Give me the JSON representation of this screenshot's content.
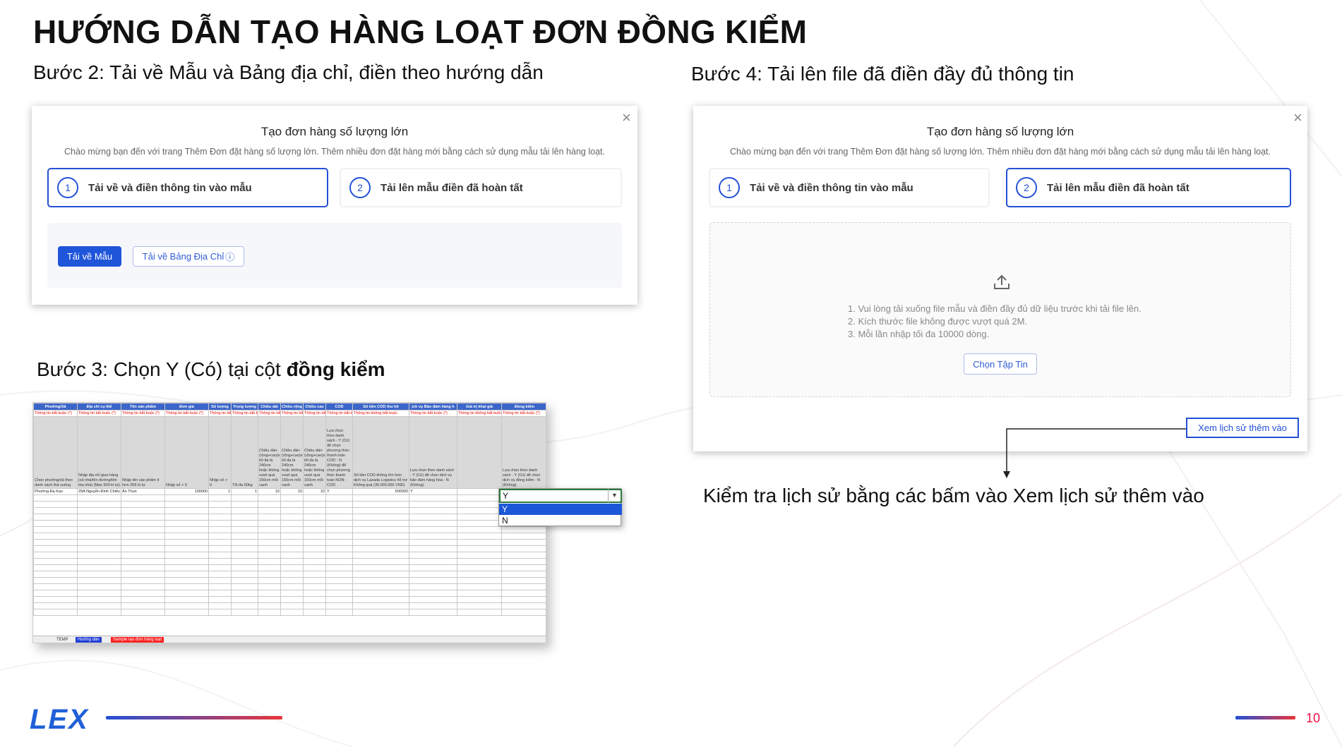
{
  "slide": {
    "title": "HƯỚNG DẪN TẠO HÀNG LOẠT ĐƠN ĐỒNG KIỂM",
    "step2": "Bước 2: Tải về Mẫu và Bảng địa chỉ, điền theo hướng dẫn",
    "step3_prefix": "Bước 3: Chọn Y (Có) tại cột ",
    "step3_bold": "đồng kiểm",
    "step4": "Bước 4: Tải lên file đã điền đầy đủ thông tin",
    "note": "Kiểm tra lịch sử bằng các bấm vào Xem lịch sử thêm vào",
    "logo": "LEX",
    "page_number": "10",
    "colors": {
      "accent_blue": "#2450d6",
      "accent_red": "#e8363c"
    }
  },
  "modal": {
    "title": "Tạo đơn hàng số lượng lớn",
    "description": "Chào mừng bạn đến với trang Thêm Đơn đặt hàng số lượng lớn. Thêm nhiều đơn đặt hàng mới bằng cách sử dụng mẫu tải lên hàng loạt.",
    "close_icon": "×",
    "step1_num": "1",
    "step1_label": "Tải về và điền thông tin vào mẫu",
    "step2_num": "2",
    "step2_label": "Tải lên mẫu điền đã hoàn tất",
    "download_template": "Tải về Mẫu",
    "download_address": "Tải về Bảng Địa Chỉ",
    "info_icon": "ⓘ",
    "upload_hints": [
      "1. Vui lòng tải xuống file mẫu và điền đầy đủ dữ liệu trước khi tải file lên.",
      "2. Kích thước file không được vượt quá 2M.",
      "3. Mỗi lần nhập tối đa 10000 dòng."
    ],
    "choose_file": "Chọn Tập Tin",
    "view_history": "Xem lịch sử thêm vào"
  },
  "sheet": {
    "headers": [
      "Phường/Xã",
      "Địa chỉ cụ thể",
      "Tên sản phẩm",
      "Đơn giá",
      "Số lượng",
      "Trọng lượng",
      "Chiều dài",
      "Chiều rộng",
      "Chiều cao",
      "COD",
      "Số tiền COD thu hộ",
      "ịch vụ Bảo đảm hàng h",
      "Giá trị khai giá",
      "Đồng kiểm"
    ],
    "required": [
      "Thông tin bắt buộc (*)",
      "Thông tin bắt buộc (*)",
      "Thông tin bắt buộc (*)",
      "Thông tin bắt buộc (*)",
      "Thông tin bắt buộc",
      "Thông tin bắt buộc",
      "Thông tin bắt buộc",
      "Thông tin bắt buộc",
      "Thông tin bắt buộc",
      "Thông tin bắt buộc",
      "Thông tin không bắt buộc",
      "Thông tin bắt buộc (*)",
      "Thông tin không bắt buộc",
      "Thông tin bắt buộc (*)"
    ],
    "descriptions": [
      "Chọn phường/xã theo danh sách thả xuống",
      "Nhập địa chỉ giao hàng (số nhà/tên đường/tên tòa nhà) (Max 500 kí tự)",
      "Nhập tên sản phẩm ít hơn 255 kí tự",
      "Nhập số > 0",
      "Nhập số > 0",
      "Tối đa 50kg",
      "Chiều dài+(rộng+cao)x2 tối đa là 240cm hoặc không vượt quá 150cm mỗi cạnh",
      "Chiều dài+(rộng+cao)x2 tối đa là 240cm hoặc không vượt quá 150cm mỗi cạnh",
      "Chiều dài+(rộng+cao)x2 tối đa là 240cm hoặc không vượt quá 150cm mỗi cạnh",
      "Lựa chọn theo danh sách - Y (Có) để chọn phương thức thanh toán COD - N (Không) để chọn phương thức thanh toán NON-COD",
      "Số tiền COD không lớn hơn dịch vụ Lazada Logistics hỗ trợ Không quá (30.000.000 VND)",
      "Lựa chọn theo danh sách - Y (Có) để chọn dịch vụ bảo đảm hàng hóa - N (Không)",
      "",
      "Lựa chọn theo danh sách - Y (Có) để chọn dịch vụ đồng kiểm - N (Không)"
    ],
    "row": [
      "Phường Đa Kao",
      "29A Nguyễn Đình Chiểu",
      "Áo Thun",
      "100000",
      "1",
      "1",
      "10",
      "10",
      "10",
      "Y",
      "500000",
      "Y",
      "",
      ""
    ],
    "tabs": [
      "TEMP",
      "Hướng dẫn",
      "Sample tạo đơn hàng loạt"
    ],
    "dropdown_value": "Y",
    "dropdown_options": [
      "Y",
      "N"
    ]
  }
}
